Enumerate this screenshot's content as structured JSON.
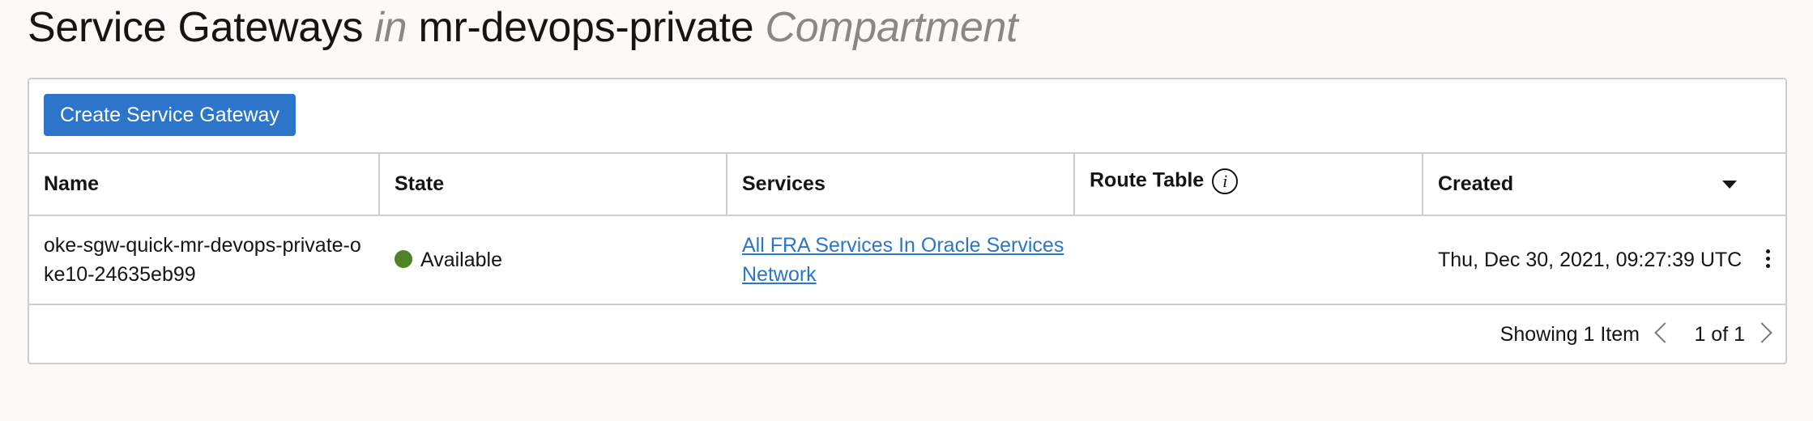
{
  "header": {
    "title_main": "Service Gateways",
    "title_in": "in",
    "compartment_name": "mr-devops-private",
    "compartment_label": "Compartment"
  },
  "toolbar": {
    "create_label": "Create Service Gateway"
  },
  "table": {
    "columns": {
      "name": "Name",
      "state": "State",
      "services": "Services",
      "route_table": "Route Table",
      "created": "Created"
    },
    "rows": [
      {
        "name": "oke-sgw-quick-mr-devops-private-oke10-24635eb99",
        "state": "Available",
        "services": "All FRA Services In Oracle Services Network",
        "route_table": "",
        "created": "Thu, Dec 30, 2021, 09:27:39 UTC"
      }
    ]
  },
  "footer": {
    "count_text": "Showing 1 Item",
    "page_text": "1 of 1"
  },
  "colors": {
    "primary": "#2c75c9",
    "status_available": "#508223",
    "link": "#2c75c9"
  },
  "icons": {
    "info": "info-icon",
    "sort": "caret-down-icon",
    "actions": "kebab-menu-icon",
    "prev": "chevron-left-icon",
    "next": "chevron-right-icon"
  }
}
